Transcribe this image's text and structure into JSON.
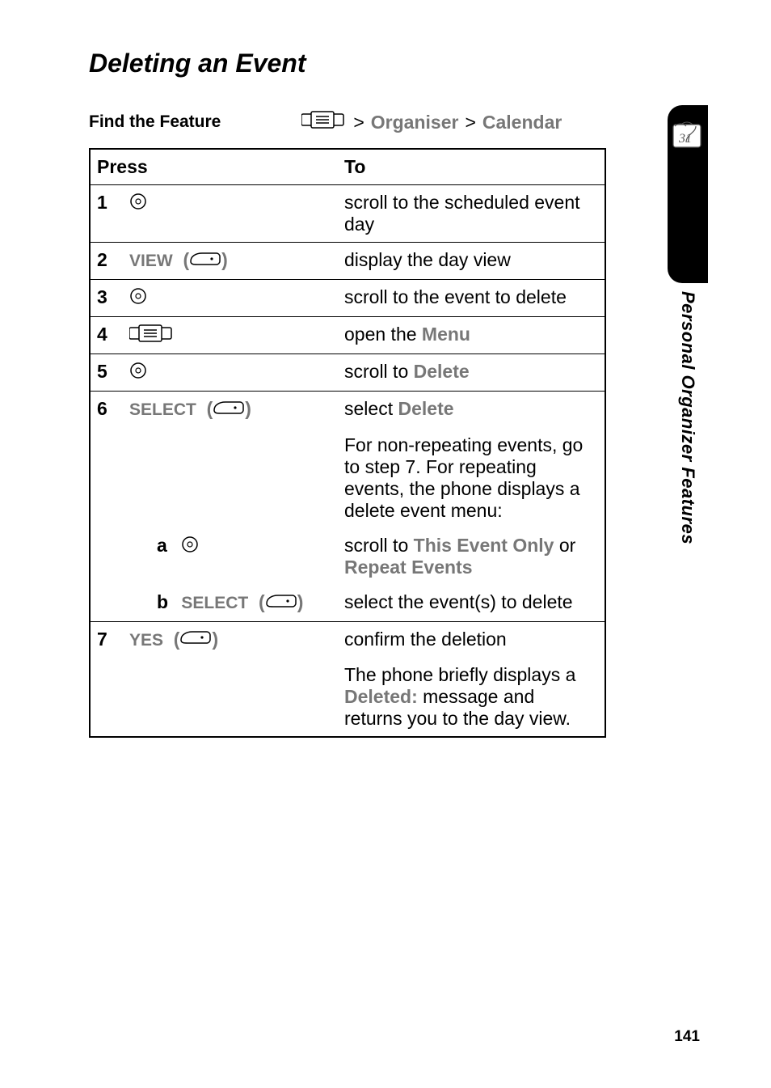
{
  "title": "Deleting an Event",
  "find_feature_label": "Find the Feature",
  "breadcrumb": {
    "sep": ">",
    "part1": "Organiser",
    "part2": "Calendar"
  },
  "table": {
    "header": {
      "press": "Press",
      "to": "To"
    },
    "rows": [
      {
        "num": "1",
        "press_type": "nav",
        "to_plain": "scroll to the scheduled event day"
      },
      {
        "num": "2",
        "press_type": "soft",
        "label": "VIEW",
        "to_plain": "display the day view"
      },
      {
        "num": "3",
        "press_type": "nav",
        "to_plain": "scroll to the event to delete"
      },
      {
        "num": "4",
        "press_type": "menu",
        "to_parts": [
          "open the  ",
          "Menu"
        ],
        "to_styles": [
          "plain",
          "menu"
        ]
      },
      {
        "num": "5",
        "press_type": "nav",
        "to_parts": [
          "scroll to ",
          "Delete"
        ],
        "to_styles": [
          "plain",
          "menu"
        ]
      },
      {
        "num": "6",
        "press_type": "soft",
        "label": "SELECT",
        "to_parts": [
          "select ",
          "Delete"
        ],
        "to_styles": [
          "plain",
          "menu"
        ]
      }
    ],
    "row6_note": "For non-repeating events, go to step 7. For repeating events, the phone displays a delete event menu:",
    "sub_a": {
      "letter": "a",
      "press_type": "nav",
      "to_parts": [
        "scroll to ",
        "This Event Only",
        " or ",
        "Repeat Events"
      ],
      "to_styles": [
        "plain",
        "menu",
        "plain",
        "menu"
      ]
    },
    "sub_b": {
      "letter": "b",
      "press_type": "soft",
      "label": "SELECT",
      "to_plain": "select the event(s) to delete"
    },
    "row7": {
      "num": "7",
      "press_type": "soft",
      "label": "YES",
      "to_plain": "confirm the deletion"
    },
    "row7_note_parts": [
      "The phone briefly displays a ",
      "Deleted:",
      " message and returns you to the day view."
    ],
    "row7_note_styles": [
      "plain",
      "menu",
      "plain"
    ]
  },
  "side_label": "Personal Organizer Features",
  "page_number": "141"
}
